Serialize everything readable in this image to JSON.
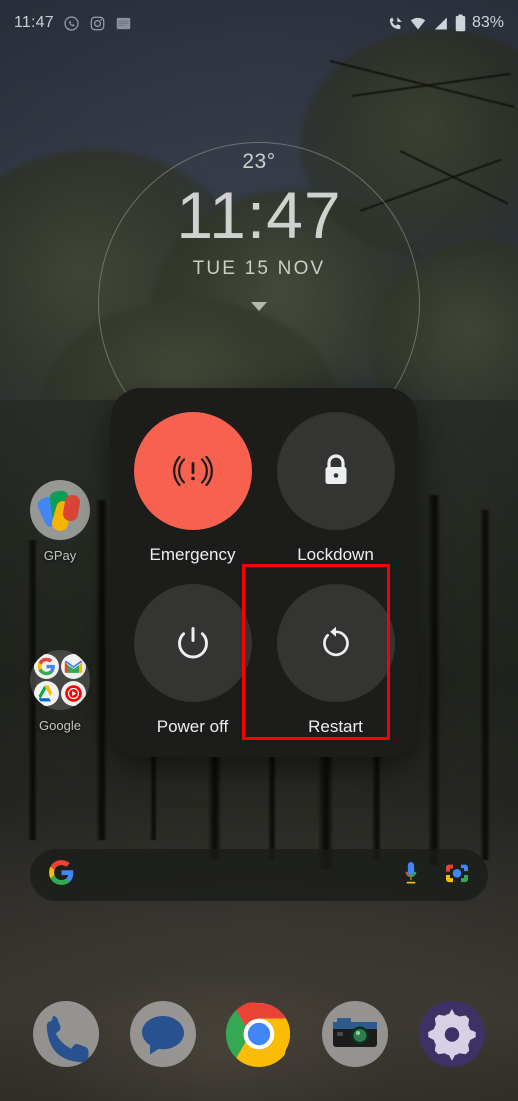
{
  "status_bar": {
    "clock": "11:47",
    "battery_percent": "83%",
    "left_icons": [
      {
        "name": "whatsapp-notification-icon",
        "glyph": "whatsapp"
      },
      {
        "name": "instagram-notification-icon",
        "glyph": "instagram"
      },
      {
        "name": "generic-notification-icon",
        "glyph": "square"
      }
    ],
    "right_icons": [
      {
        "name": "call-forwarding-icon",
        "glyph": "phone"
      },
      {
        "name": "wifi-icon",
        "glyph": "wifi"
      },
      {
        "name": "mobile-signal-icon",
        "glyph": "signal"
      },
      {
        "name": "battery-icon",
        "glyph": "battery"
      }
    ]
  },
  "clock_widget": {
    "temperature": "23°",
    "time": "11:47",
    "date": "TUE 15 NOV",
    "expand_icon": "chevron-down-icon"
  },
  "home_icons": [
    {
      "name": "gpay",
      "label": "GPay"
    },
    {
      "name": "google-folder",
      "label": "Google",
      "children": [
        {
          "name": "google-search",
          "letter": "G"
        },
        {
          "name": "gmail",
          "letter": "M"
        },
        {
          "name": "google-drive",
          "letter": "▲"
        },
        {
          "name": "youtube-music",
          "letter": "▶"
        }
      ]
    }
  ],
  "search_bar": {
    "placeholder": "",
    "logo_icon": "google-g-icon",
    "mic_icon": "microphone-icon",
    "lens_icon": "google-lens-camera-icon"
  },
  "dock": [
    {
      "name": "phone-app",
      "label": "Phone",
      "icon": "phone-handset-icon"
    },
    {
      "name": "messages-app",
      "label": "Messages",
      "icon": "chat-bubble-icon"
    },
    {
      "name": "chrome-app",
      "label": "Chrome",
      "icon": "chrome-icon"
    },
    {
      "name": "camera-app",
      "label": "Camera",
      "icon": "camera-icon"
    },
    {
      "name": "settings-app",
      "label": "Settings",
      "icon": "gear-icon"
    }
  ],
  "power_menu": {
    "items": [
      {
        "name": "emergency",
        "label": "Emergency",
        "icon": "emergency-broadcast-icon",
        "style": "danger",
        "highlighted": false
      },
      {
        "name": "lockdown",
        "label": "Lockdown",
        "icon": "lock-icon",
        "style": "normal",
        "highlighted": false
      },
      {
        "name": "power-off",
        "label": "Power off",
        "icon": "power-icon",
        "style": "normal",
        "highlighted": false
      },
      {
        "name": "restart",
        "label": "Restart",
        "icon": "restart-icon",
        "style": "normal",
        "highlighted": true
      }
    ]
  },
  "colors": {
    "emergency_red": "#F8614F",
    "dialog_bg": "#1C1C1B",
    "button_bg": "#343433",
    "highlight_outline": "#FB0000",
    "label_text": "#ECEFF1"
  }
}
